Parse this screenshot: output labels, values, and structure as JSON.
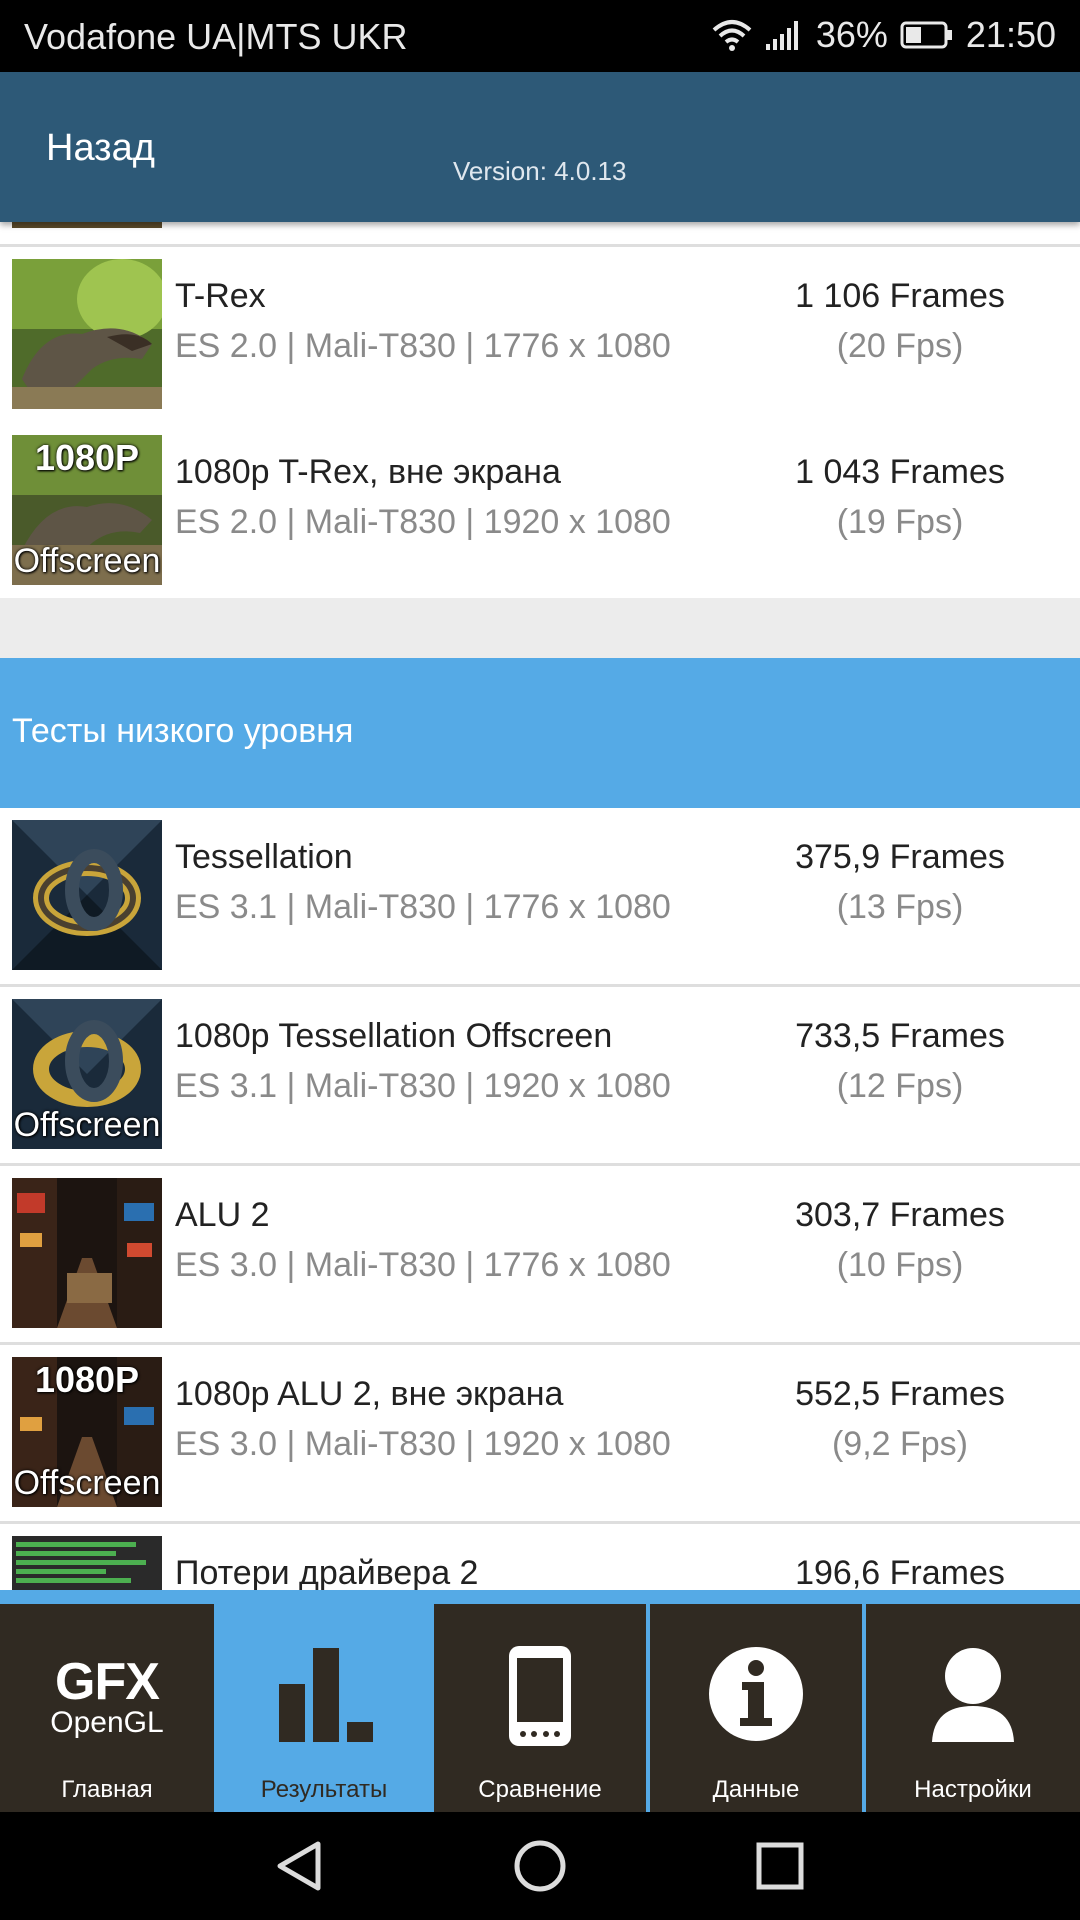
{
  "status_bar": {
    "carrier": "Vodafone UA|MTS UKR",
    "battery": "36%",
    "time": "21:50"
  },
  "header": {
    "back_label": "Назад",
    "version": "Version: 4.0.13"
  },
  "results_top": [
    {
      "title": "T-Rex",
      "subtitle": "ES 2.0 | Mali-T830 | 1776 x 1080",
      "frames": "1 106 Frames",
      "fps": "(20 Fps)",
      "thumb_top": "",
      "thumb_bottom": ""
    },
    {
      "title": "1080p T-Rex, вне экрана",
      "subtitle": "ES 2.0 | Mali-T830 | 1920 x 1080",
      "frames": "1 043 Frames",
      "fps": "(19 Fps)",
      "thumb_top": "1080P",
      "thumb_bottom": "Offscreen"
    }
  ],
  "section": {
    "title": "Тесты низкого уровня"
  },
  "results_low": [
    {
      "title": "Tessellation",
      "subtitle": "ES 3.1 | Mali-T830 | 1776 x 1080",
      "frames": "375,9 Frames",
      "fps": "(13 Fps)",
      "thumb_top": "",
      "thumb_bottom": ""
    },
    {
      "title": "1080p Tessellation Offscreen",
      "subtitle": "ES 3.1 | Mali-T830 | 1920 x 1080",
      "frames": "733,5 Frames",
      "fps": "(12 Fps)",
      "thumb_top": "",
      "thumb_bottom": "Offscreen"
    },
    {
      "title": "ALU 2",
      "subtitle": "ES 3.0 | Mali-T830 | 1776 x 1080",
      "frames": "303,7 Frames",
      "fps": "(10 Fps)",
      "thumb_top": "",
      "thumb_bottom": ""
    },
    {
      "title": "1080p ALU 2, вне экрана",
      "subtitle": "ES 3.0 | Mali-T830 | 1920 x 1080",
      "frames": "552,5 Frames",
      "fps": "(9,2 Fps)",
      "thumb_top": "1080P",
      "thumb_bottom": "Offscreen"
    },
    {
      "title": "Потери драйвера 2",
      "subtitle": "",
      "frames": "196,6 Frames",
      "fps": "",
      "thumb_top": "",
      "thumb_bottom": ""
    }
  ],
  "tabs": [
    {
      "label": "Главная",
      "logo_top": "GFX",
      "logo_bottom": "OpenGL"
    },
    {
      "label": "Результаты"
    },
    {
      "label": "Сравнение"
    },
    {
      "label": "Данные"
    },
    {
      "label": "Настройки"
    }
  ],
  "colors": {
    "header": "#2d5977",
    "accent": "#55aae6",
    "tab_bg": "#302a22"
  },
  "icons": {
    "home": "gfx-opengl-logo",
    "results": "bar-chart-icon",
    "compare": "phone-icon",
    "data": "info-icon",
    "settings": "user-icon"
  }
}
